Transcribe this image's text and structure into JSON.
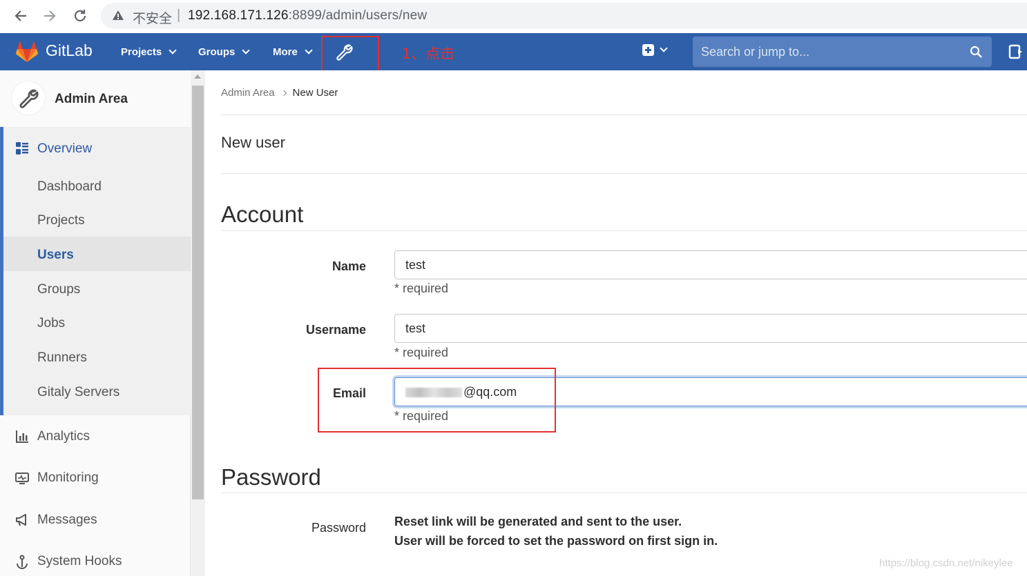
{
  "browser": {
    "insecure_label": "不安全",
    "url_host": "192.168.171.126",
    "url_path": ":8899/admin/users/new"
  },
  "header": {
    "app_name": "GitLab",
    "menus": [
      "Projects",
      "Groups",
      "More"
    ],
    "search_placeholder": "Search or jump to...",
    "annotation": "1、点击",
    "brand_color": "#2f5fa9"
  },
  "sidebar": {
    "title": "Admin Area",
    "overview_label": "Overview",
    "overview_items": [
      "Dashboard",
      "Projects",
      "Users",
      "Groups",
      "Jobs",
      "Runners",
      "Gitaly Servers"
    ],
    "current_item": "Users",
    "other_items": [
      {
        "label": "Analytics",
        "icon": "analytics-icon"
      },
      {
        "label": "Monitoring",
        "icon": "monitoring-icon"
      },
      {
        "label": "Messages",
        "icon": "messages-icon"
      },
      {
        "label": "System Hooks",
        "icon": "hooks-icon"
      }
    ]
  },
  "breadcrumb": {
    "parent": "Admin Area",
    "current": "New User"
  },
  "page": {
    "title": "New user",
    "account_section": "Account",
    "password_section": "Password"
  },
  "form": {
    "name_label": "Name",
    "name_value": "test",
    "username_label": "Username",
    "username_value": "test",
    "email_label": "Email",
    "email_value": "@qq.com",
    "required_hint": "* required",
    "password_label": "Password",
    "password_line1": "Reset link will be generated and sent to the user.",
    "password_line2": "User will be forced to set the password on first sign in."
  },
  "watermark": "https://blog.csdn.net/nikeylee"
}
